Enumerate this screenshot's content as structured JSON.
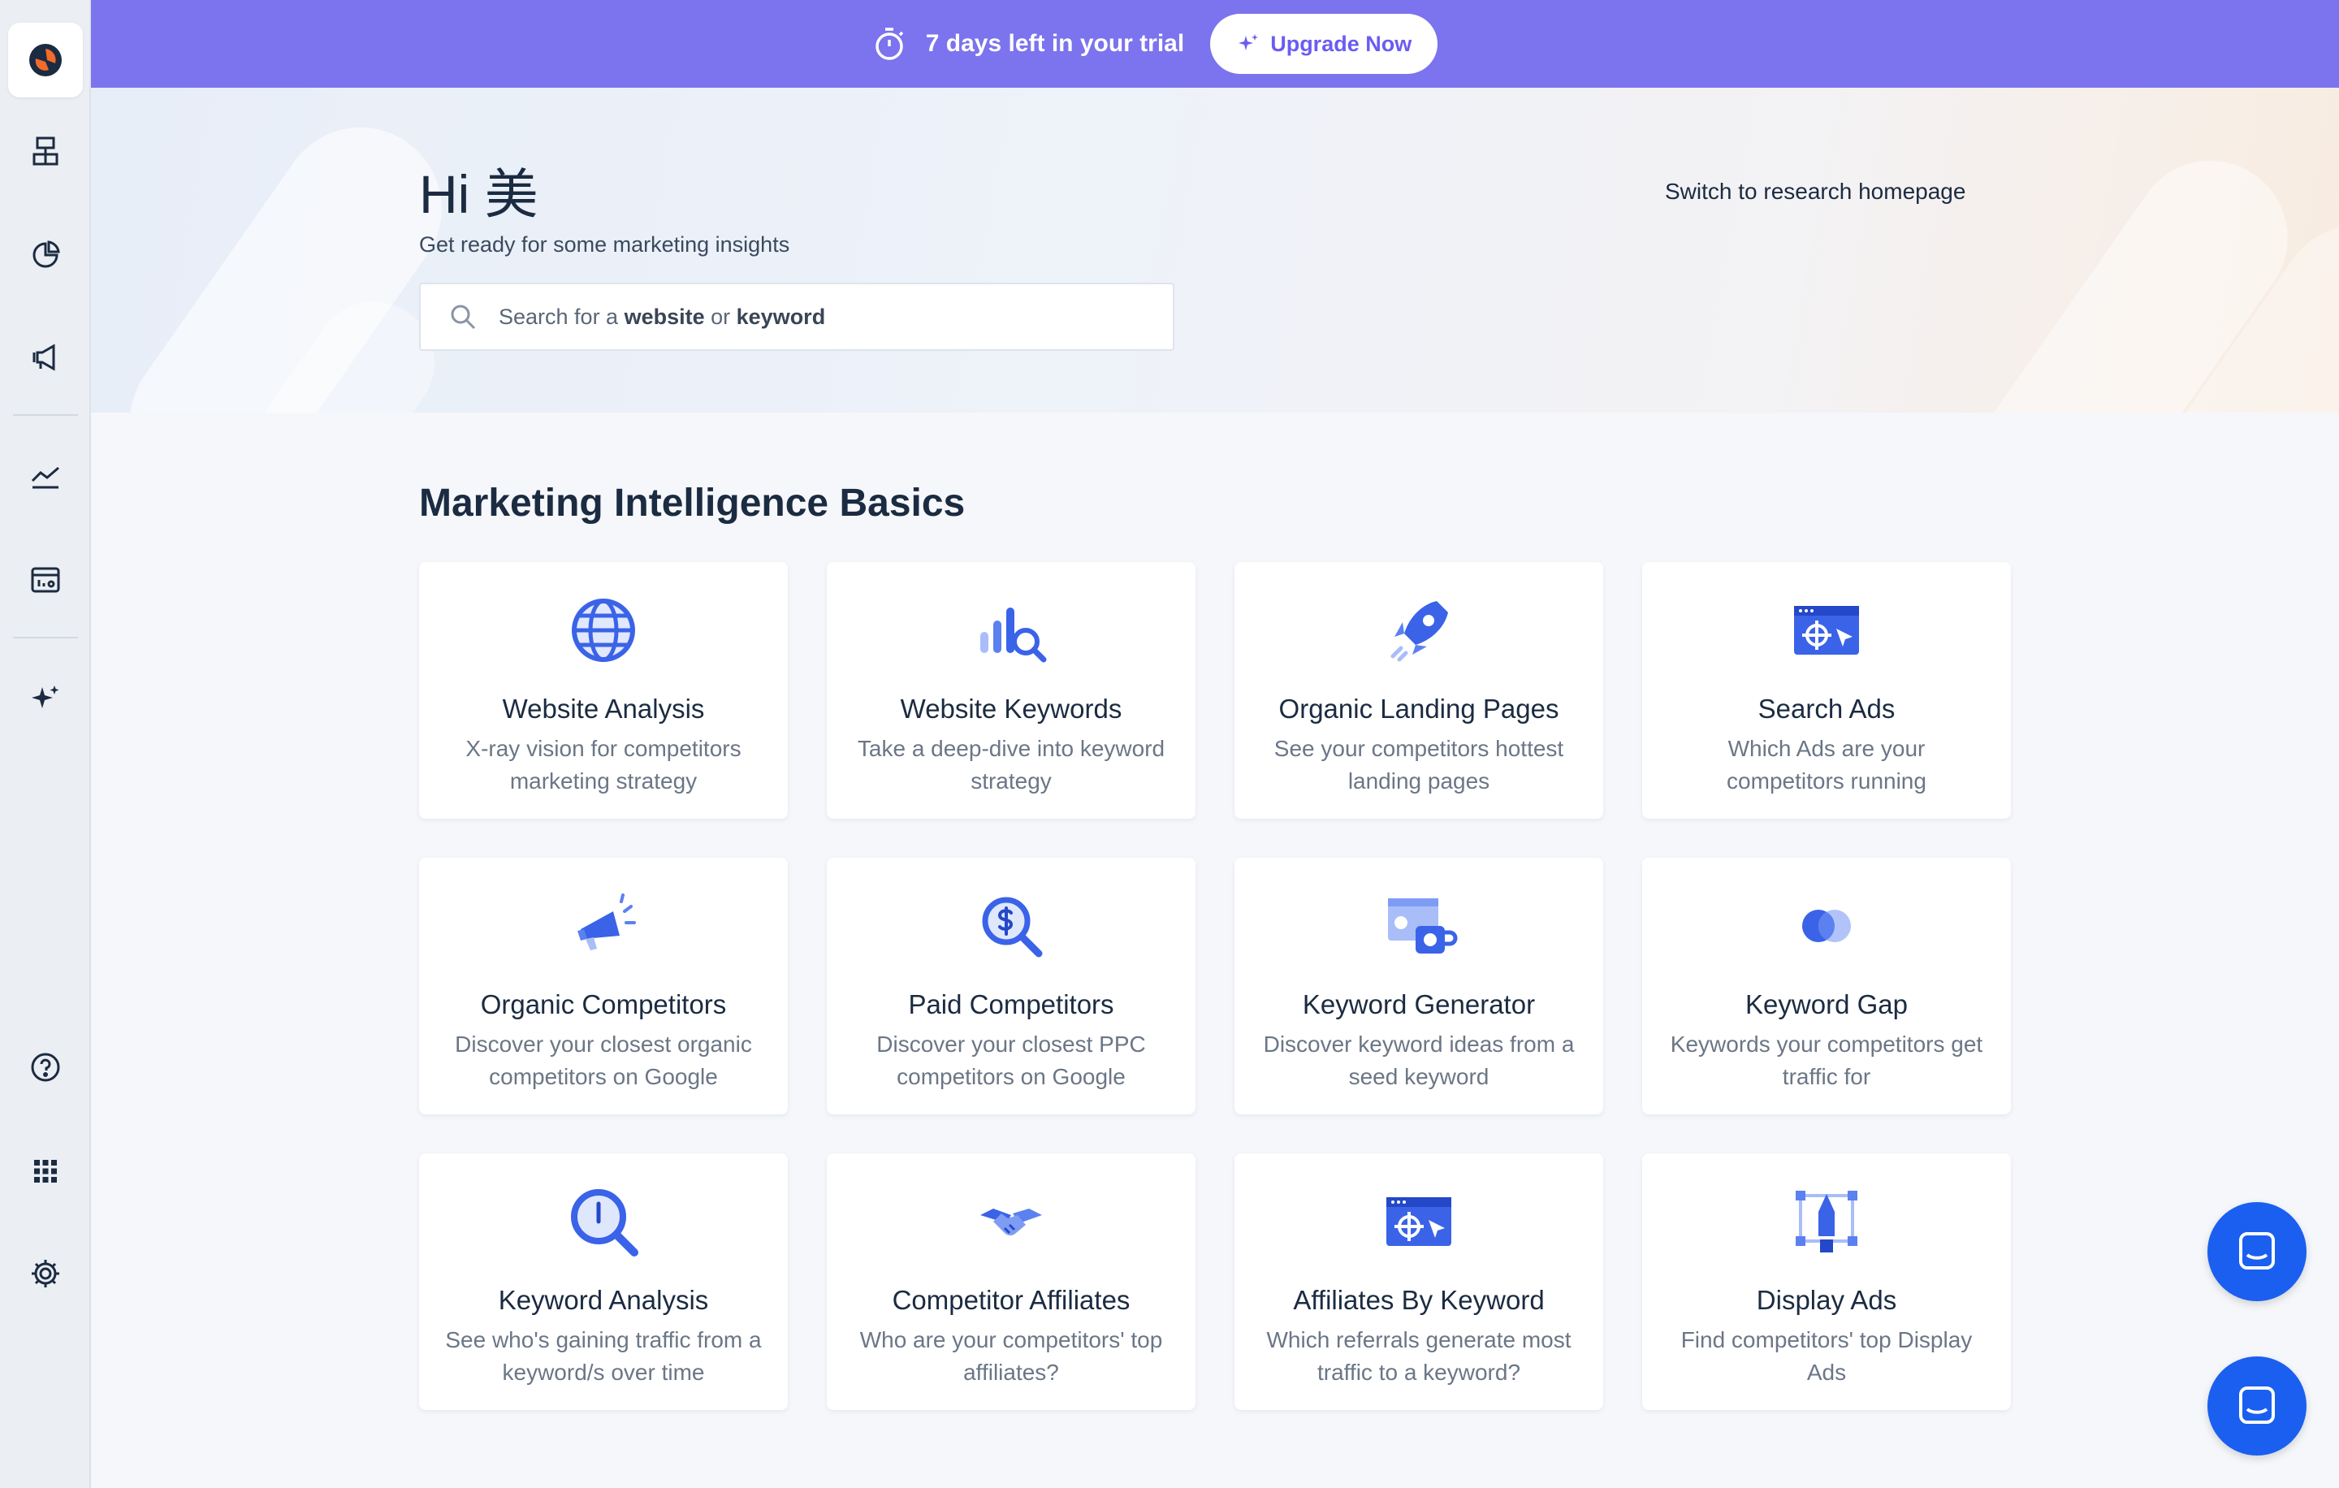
{
  "sidebar": {
    "items": [
      {
        "icon": "trophy-icon"
      },
      {
        "icon": "pie-chart-icon"
      },
      {
        "icon": "megaphone-icon"
      },
      {
        "icon": "trend-line-icon"
      },
      {
        "icon": "dashboard-icon"
      },
      {
        "icon": "sparkles-icon"
      },
      {
        "icon": "help-icon"
      },
      {
        "icon": "apps-grid-icon"
      },
      {
        "icon": "settings-icon"
      }
    ]
  },
  "banner": {
    "trial_text": "7 days left in your trial",
    "upgrade_label": "Upgrade Now",
    "background": "#7c73ee"
  },
  "hero": {
    "greeting": "Hi 美",
    "subtitle": "Get ready for some marketing insights",
    "search_prefix": "Search for a ",
    "search_bold1": "website",
    "search_mid": " or ",
    "search_bold2": "keyword",
    "switch_link": "Switch to research homepage"
  },
  "section": {
    "title": "Marketing Intelligence Basics",
    "cards": [
      {
        "title": "Website Analysis",
        "desc": "X-ray vision for competitors marketing strategy",
        "icon": "globe-icon"
      },
      {
        "title": "Website Keywords",
        "desc": "Take a deep-dive into keyword strategy",
        "icon": "bar-magnifier-icon"
      },
      {
        "title": "Organic Landing Pages",
        "desc": "See your competitors hottest landing pages",
        "icon": "rocket-icon"
      },
      {
        "title": "Search Ads",
        "desc": "Which Ads are your competitors running",
        "icon": "browser-target-icon"
      },
      {
        "title": "Organic Competitors",
        "desc": "Discover your closest organic competitors on Google",
        "icon": "megaphone-icon"
      },
      {
        "title": "Paid Competitors",
        "desc": "Discover your closest PPC competitors on Google",
        "icon": "dollar-magnifier-icon"
      },
      {
        "title": "Keyword Generator",
        "desc": "Discover keyword ideas from a seed keyword",
        "icon": "keyword-generator-icon"
      },
      {
        "title": "Keyword Gap",
        "desc": "Keywords your competitors get traffic for",
        "icon": "overlap-circles-icon"
      },
      {
        "title": "Keyword Analysis",
        "desc": "See who's gaining traffic from a keyword/s over time",
        "icon": "magnifier-icon"
      },
      {
        "title": "Competitor Affiliates",
        "desc": "Who are your competitors' top affiliates?",
        "icon": "handshake-icon"
      },
      {
        "title": "Affiliates By Keyword",
        "desc": "Which referrals generate most traffic to a keyword?",
        "icon": "browser-target-icon"
      },
      {
        "title": "Display Ads",
        "desc": "Find competitors' top Display Ads",
        "icon": "pen-tool-icon"
      }
    ]
  },
  "colors": {
    "accent": "#1a5ff0",
    "icon_blue": "#3a63e8",
    "icon_light": "#a9bdf8"
  }
}
